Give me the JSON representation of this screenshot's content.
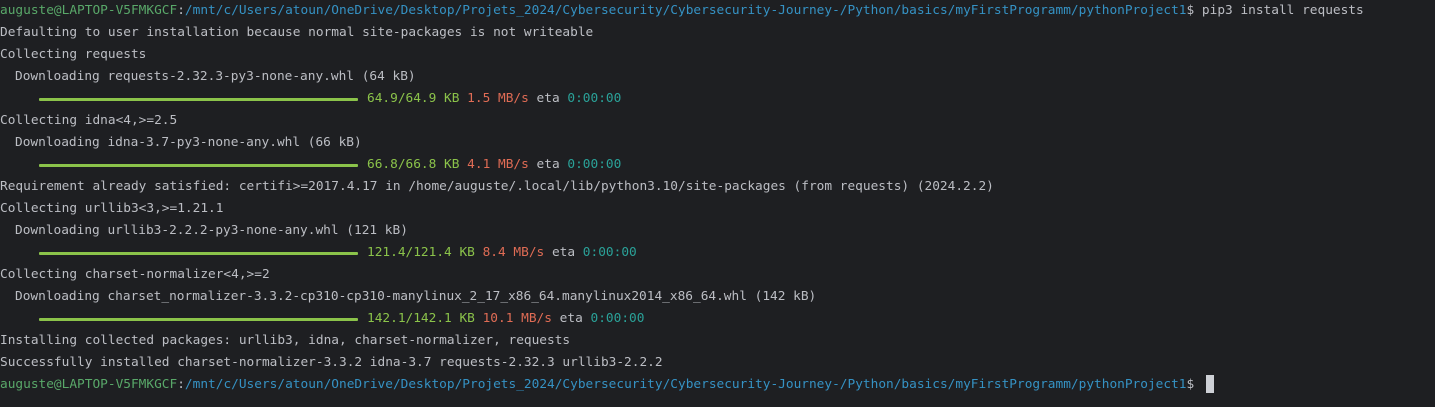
{
  "prompt": {
    "user_host": "auguste@LAPTOP-V5FMKGCF",
    "separator": ":",
    "path": "/mnt/c/Users/atoun/OneDrive/Desktop/Projets_2024/Cybersecurity/Cybersecurity-Journey-/Python/basics/myFirstProgramm/pythonProject1",
    "symbol": "$ "
  },
  "command": "pip3 install requests",
  "output": {
    "l1": "Defaulting to user installation because normal site-packages is not writeable",
    "l2": "Collecting requests",
    "l3": "Downloading requests-2.32.3-py3-none-any.whl (64 kB)",
    "l5": "Collecting idna<4,>=2.5",
    "l6": "Downloading idna-3.7-py3-none-any.whl (66 kB)",
    "l8": "Requirement already satisfied: certifi>=2017.4.17 in /home/auguste/.local/lib/python3.10/site-packages (from requests) (2024.2.2)",
    "l9": "Collecting urllib3<3,>=1.21.1",
    "l10": "Downloading urllib3-2.2.2-py3-none-any.whl (121 kB)",
    "l12": "Collecting charset-normalizer<4,>=2",
    "l13": "Downloading charset_normalizer-3.3.2-cp310-cp310-manylinux_2_17_x86_64.manylinux2014_x86_64.whl (142 kB)",
    "l15": "Installing collected packages: urllib3, idna, charset-normalizer, requests",
    "l16": "Successfully installed charset-normalizer-3.3.2 idna-3.7 requests-2.32.3 urllib3-2.2.2"
  },
  "progress": [
    {
      "size": "64.9/64.9 KB",
      "speed": "1.5 MB/s",
      "eta_label": "eta",
      "eta": "0:00:00",
      "fraction": 1.0
    },
    {
      "size": "66.8/66.8 KB",
      "speed": "4.1 MB/s",
      "eta_label": "eta",
      "eta": "0:00:00",
      "fraction": 1.0
    },
    {
      "size": "121.4/121.4 KB",
      "speed": "8.4 MB/s",
      "eta_label": "eta",
      "eta": "0:00:00",
      "fraction": 1.0
    },
    {
      "size": "142.1/142.1 KB",
      "speed": "10.1 MB/s",
      "eta_label": "eta",
      "eta": "0:00:00",
      "fraction": 1.0
    }
  ],
  "colors": {
    "background": "#1e1f22",
    "text": "#bcbec4",
    "user_host": "#59a869",
    "path": "#3592c4",
    "progress_bar": "#8bc34a",
    "speed": "#e06c55",
    "eta": "#2aa198"
  }
}
